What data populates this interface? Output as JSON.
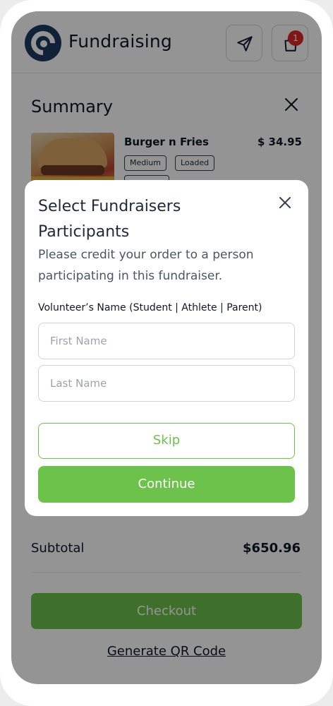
{
  "header": {
    "title": "Fundraising",
    "cart_count": "1"
  },
  "summary": {
    "title": "Summary",
    "item": {
      "name": "Burger n Fries",
      "price": "$ 34.95",
      "tags": [
        "Medium",
        "Loaded",
        ""
      ]
    },
    "subtotal_label": "Subtotal",
    "subtotal_value": "$650.96",
    "checkout_label": "Checkout",
    "qr_label": "Generate QR Code"
  },
  "modal": {
    "title": "Select Fundraisers Participants",
    "description": "Please credit your order to a person participating in this fundraiser.",
    "field_label": "Volunteer’s Name (Student | Athlete | Parent)",
    "first_name_placeholder": "First Name",
    "last_name_placeholder": "Last Name",
    "skip_label": "Skip",
    "continue_label": "Continue"
  },
  "colors": {
    "brand_navy": "#1e3a5f",
    "accent_green": "#6cc24a",
    "badge_red": "#dc2626"
  }
}
